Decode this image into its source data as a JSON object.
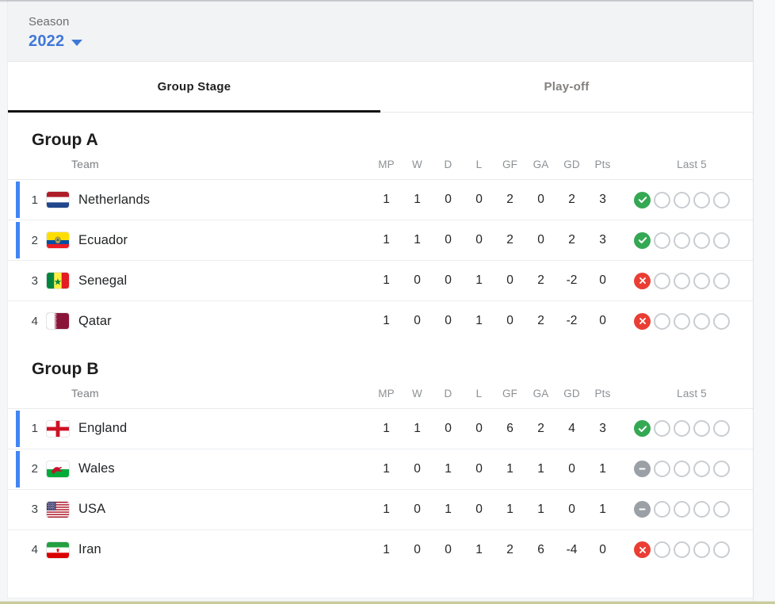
{
  "header": {
    "season_label": "Season",
    "season_value": "2022",
    "dropdown_icon": "chevron-down-icon"
  },
  "tabs": [
    {
      "label": "Group Stage",
      "active": true
    },
    {
      "label": "Play-off",
      "active": false
    }
  ],
  "columns": {
    "team": "Team",
    "mp": "MP",
    "w": "W",
    "d": "D",
    "l": "L",
    "gf": "GF",
    "ga": "GA",
    "gd": "GD",
    "pts": "Pts",
    "last5": "Last 5"
  },
  "colors": {
    "qualified_bar": "#4285f4",
    "win": "#34a853",
    "loss": "#ea3e35",
    "draw": "#9aa0a6",
    "accent_link": "#4078d8",
    "tab_underline": "#111111"
  },
  "groups": [
    {
      "title": "Group A",
      "rows": [
        {
          "rank": "1",
          "team": "Netherlands",
          "flag": "flag-netherlands",
          "qualified": true,
          "mp": "1",
          "w": "1",
          "d": "0",
          "l": "0",
          "gf": "2",
          "ga": "0",
          "gd": "2",
          "pts": "3",
          "last5": [
            "win",
            "none",
            "none",
            "none",
            "none"
          ]
        },
        {
          "rank": "2",
          "team": "Ecuador",
          "flag": "flag-ecuador",
          "qualified": true,
          "mp": "1",
          "w": "1",
          "d": "0",
          "l": "0",
          "gf": "2",
          "ga": "0",
          "gd": "2",
          "pts": "3",
          "last5": [
            "win",
            "none",
            "none",
            "none",
            "none"
          ]
        },
        {
          "rank": "3",
          "team": "Senegal",
          "flag": "flag-senegal",
          "qualified": false,
          "mp": "1",
          "w": "0",
          "d": "0",
          "l": "1",
          "gf": "0",
          "ga": "2",
          "gd": "-2",
          "pts": "0",
          "last5": [
            "loss",
            "none",
            "none",
            "none",
            "none"
          ]
        },
        {
          "rank": "4",
          "team": "Qatar",
          "flag": "flag-qatar",
          "qualified": false,
          "mp": "1",
          "w": "0",
          "d": "0",
          "l": "1",
          "gf": "0",
          "ga": "2",
          "gd": "-2",
          "pts": "0",
          "last5": [
            "loss",
            "none",
            "none",
            "none",
            "none"
          ]
        }
      ]
    },
    {
      "title": "Group B",
      "rows": [
        {
          "rank": "1",
          "team": "England",
          "flag": "flag-england",
          "qualified": true,
          "mp": "1",
          "w": "1",
          "d": "0",
          "l": "0",
          "gf": "6",
          "ga": "2",
          "gd": "4",
          "pts": "3",
          "last5": [
            "win",
            "none",
            "none",
            "none",
            "none"
          ]
        },
        {
          "rank": "2",
          "team": "Wales",
          "flag": "flag-wales",
          "qualified": true,
          "mp": "1",
          "w": "0",
          "d": "1",
          "l": "0",
          "gf": "1",
          "ga": "1",
          "gd": "0",
          "pts": "1",
          "last5": [
            "draw",
            "none",
            "none",
            "none",
            "none"
          ]
        },
        {
          "rank": "3",
          "team": "USA",
          "flag": "flag-usa",
          "qualified": false,
          "mp": "1",
          "w": "0",
          "d": "1",
          "l": "0",
          "gf": "1",
          "ga": "1",
          "gd": "0",
          "pts": "1",
          "last5": [
            "draw",
            "none",
            "none",
            "none",
            "none"
          ]
        },
        {
          "rank": "4",
          "team": "Iran",
          "flag": "flag-iran",
          "qualified": false,
          "mp": "1",
          "w": "0",
          "d": "0",
          "l": "1",
          "gf": "2",
          "ga": "6",
          "gd": "-4",
          "pts": "0",
          "last5": [
            "loss",
            "none",
            "none",
            "none",
            "none"
          ]
        }
      ]
    }
  ]
}
